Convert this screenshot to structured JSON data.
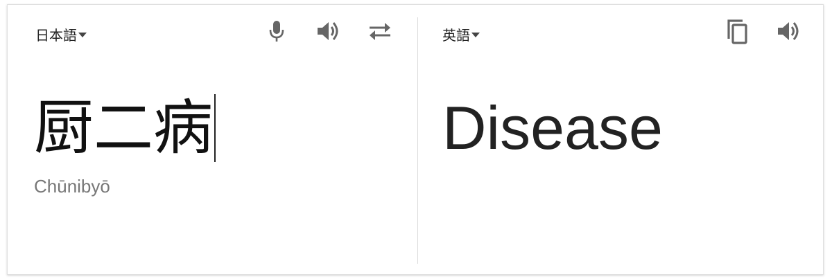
{
  "source": {
    "language": "日本語",
    "text": "厨二病",
    "romanization": "Chūnibyō"
  },
  "target": {
    "language": "英語",
    "text": "Disease"
  },
  "icons": {
    "microphone": "microphone-icon",
    "listen_source": "speaker-icon",
    "swap": "swap-languages-icon",
    "copy": "copy-icon",
    "listen_target": "speaker-icon"
  },
  "colors": {
    "icon": "#666666",
    "text": "#222222",
    "romanization": "#777777",
    "divider": "#dadada"
  }
}
